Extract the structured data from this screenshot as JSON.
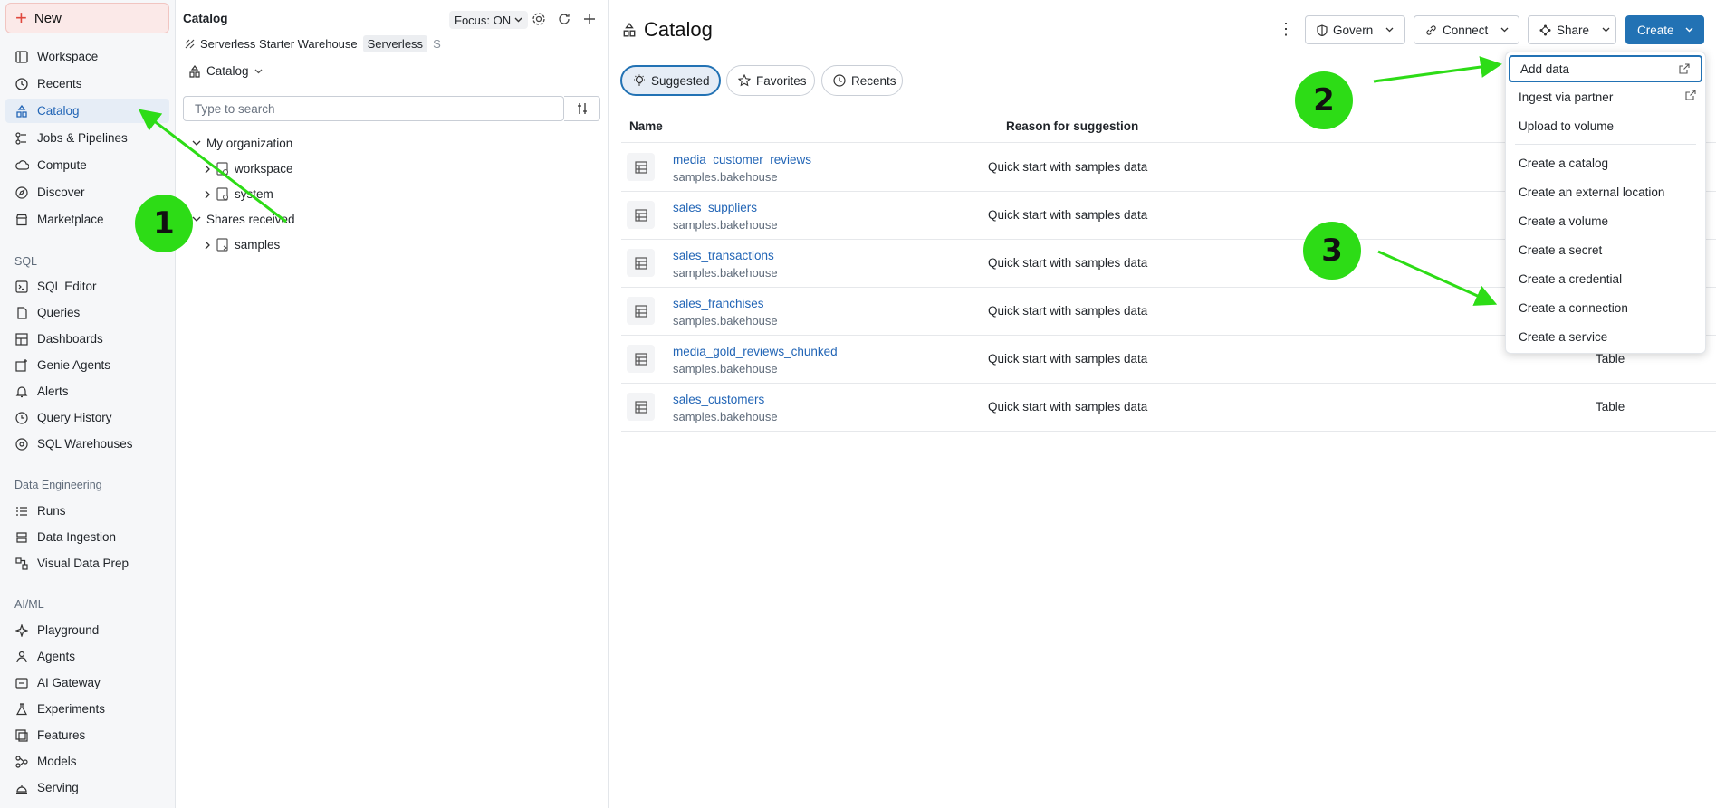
{
  "sidebar": {
    "new_label": "New",
    "items": [
      {
        "label": "Workspace",
        "icon": "workspace-icon"
      },
      {
        "label": "Recents",
        "icon": "clock-icon"
      },
      {
        "label": "Catalog",
        "icon": "catalog-icon",
        "active": true
      },
      {
        "label": "Jobs & Pipelines",
        "icon": "jobs-icon"
      },
      {
        "label": "Compute",
        "icon": "cloud-icon"
      },
      {
        "label": "Discover",
        "icon": "compass-icon"
      },
      {
        "label": "Marketplace",
        "icon": "store-icon"
      }
    ],
    "sql_section": "SQL",
    "sql_items": [
      {
        "label": "SQL Editor"
      },
      {
        "label": "Queries"
      },
      {
        "label": "Dashboards"
      },
      {
        "label": "Genie Agents"
      },
      {
        "label": "Alerts"
      },
      {
        "label": "Query History"
      },
      {
        "label": "SQL Warehouses"
      }
    ],
    "de_section": "Data Engineering",
    "de_items": [
      {
        "label": "Runs"
      },
      {
        "label": "Data Ingestion"
      },
      {
        "label": "Visual Data Prep"
      }
    ],
    "ml_section": "AI/ML",
    "ml_items": [
      {
        "label": "Playground"
      },
      {
        "label": "Agents"
      },
      {
        "label": "AI Gateway"
      },
      {
        "label": "Experiments"
      },
      {
        "label": "Features"
      },
      {
        "label": "Models"
      },
      {
        "label": "Serving"
      }
    ]
  },
  "catalog_panel": {
    "title": "Catalog",
    "focus_label": "Focus: ON",
    "warehouse_name": "Serverless Starter Warehouse",
    "warehouse_badge": "Serverless",
    "warehouse_extra": "S",
    "catalog_dropdown": "Catalog",
    "search_placeholder": "Type to search",
    "tree": {
      "org_label": "My organization",
      "org_children": [
        "workspace",
        "system"
      ],
      "shares_label": "Shares received",
      "shares_children": [
        "samples"
      ]
    }
  },
  "main": {
    "title": "Catalog",
    "buttons": {
      "govern": "Govern",
      "connect": "Connect",
      "share": "Share",
      "create": "Create"
    },
    "tabs": [
      "Suggested",
      "Favorites",
      "Recents"
    ],
    "columns": {
      "name": "Name",
      "reason": "Reason for suggestion"
    },
    "rows": [
      {
        "name": "media_customer_reviews",
        "sub": "samples.bakehouse",
        "reason": "Quick start with samples data",
        "type": ""
      },
      {
        "name": "sales_suppliers",
        "sub": "samples.bakehouse",
        "reason": "Quick start with samples data",
        "type": ""
      },
      {
        "name": "sales_transactions",
        "sub": "samples.bakehouse",
        "reason": "Quick start with samples data",
        "type": ""
      },
      {
        "name": "sales_franchises",
        "sub": "samples.bakehouse",
        "reason": "Quick start with samples data",
        "type": ""
      },
      {
        "name": "media_gold_reviews_chunked",
        "sub": "samples.bakehouse",
        "reason": "Quick start with samples data",
        "type": "Table"
      },
      {
        "name": "sales_customers",
        "sub": "samples.bakehouse",
        "reason": "Quick start with samples data",
        "type": "Table"
      }
    ]
  },
  "create_menu": {
    "group1": [
      "Add data",
      "Ingest via partner",
      "Upload to volume"
    ],
    "group2": [
      "Create a catalog",
      "Create an external location",
      "Create a volume",
      "Create a secret",
      "Create a credential",
      "Create a connection",
      "Create a service"
    ]
  },
  "annotations": [
    "1",
    "2",
    "3"
  ],
  "colors": {
    "accent": "#2272b4",
    "annotation": "#2ddc16",
    "new_button": "#e0483e"
  }
}
